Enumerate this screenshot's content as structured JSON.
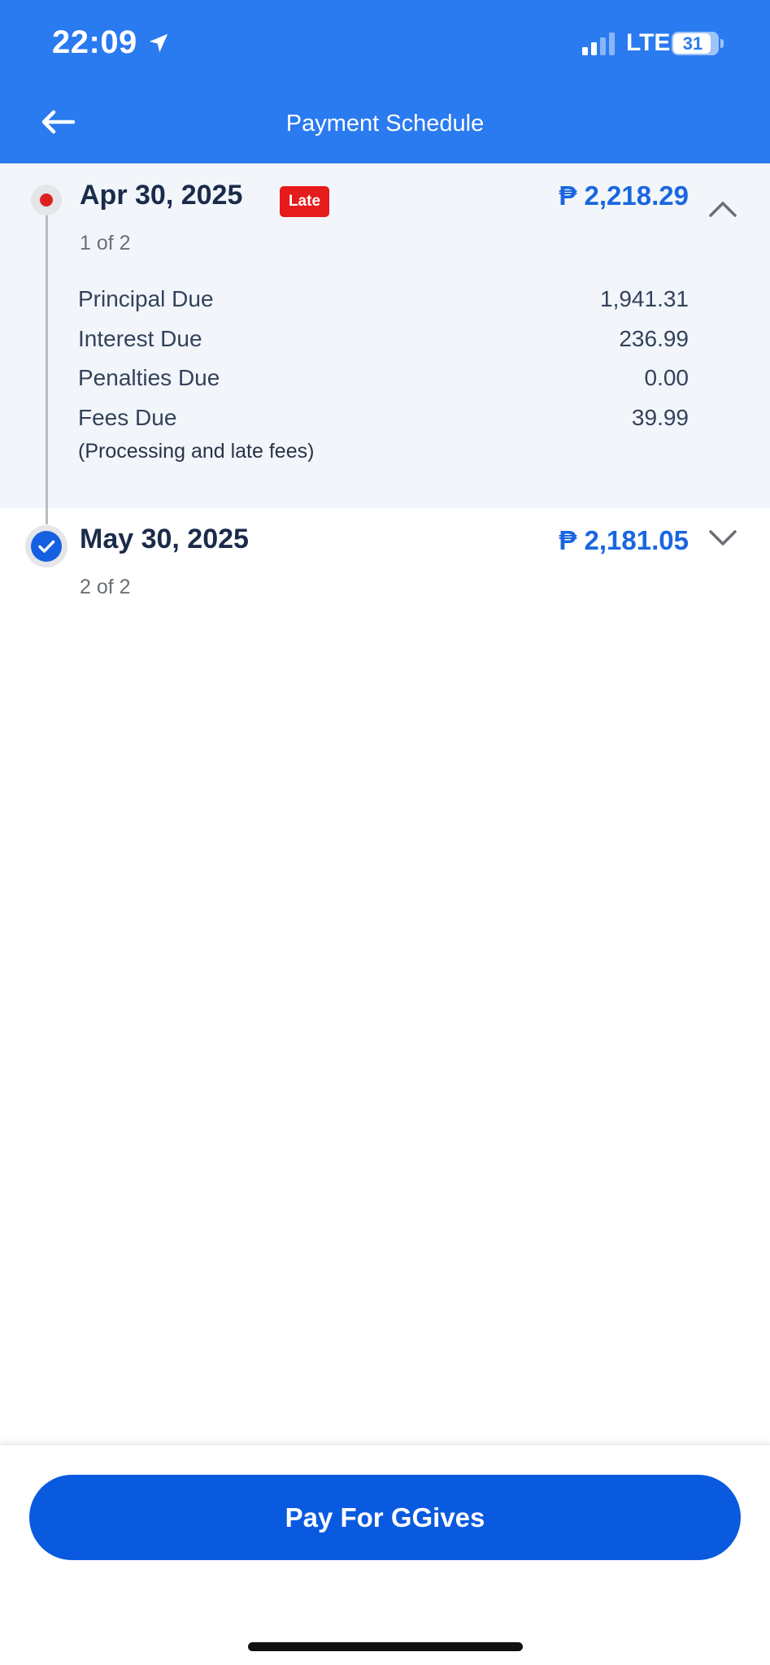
{
  "status_bar": {
    "time": "22:09",
    "network": "LTE",
    "battery": "31",
    "icons": [
      "location-arrow-icon",
      "signal-icon",
      "battery-icon"
    ]
  },
  "header": {
    "title": "Payment Schedule",
    "back_icon": "back-arrow-icon"
  },
  "schedule": [
    {
      "date": "Apr 30, 2025",
      "badge": "Late",
      "amount": "₱ 2,218.29",
      "position": "1 of 2",
      "expanded": true,
      "details": [
        {
          "label": "Principal Due",
          "value": "1,941.31"
        },
        {
          "label": "Interest Due",
          "value": "236.99"
        },
        {
          "label": "Penalties Due",
          "value": "0.00"
        },
        {
          "label": "Fees Due",
          "value": "39.99"
        }
      ],
      "fees_note": "(Processing and late fees)"
    },
    {
      "date": "May 30, 2025",
      "amount": "₱ 2,181.05",
      "position": "2 of 2",
      "expanded": false
    }
  ],
  "footer": {
    "pay_label": "Pay For GGives"
  },
  "colors": {
    "header_bg": "#2a7af0",
    "accent": "#1a66e0",
    "late_badge": "#e61b1b",
    "button": "#0a5ae0"
  }
}
